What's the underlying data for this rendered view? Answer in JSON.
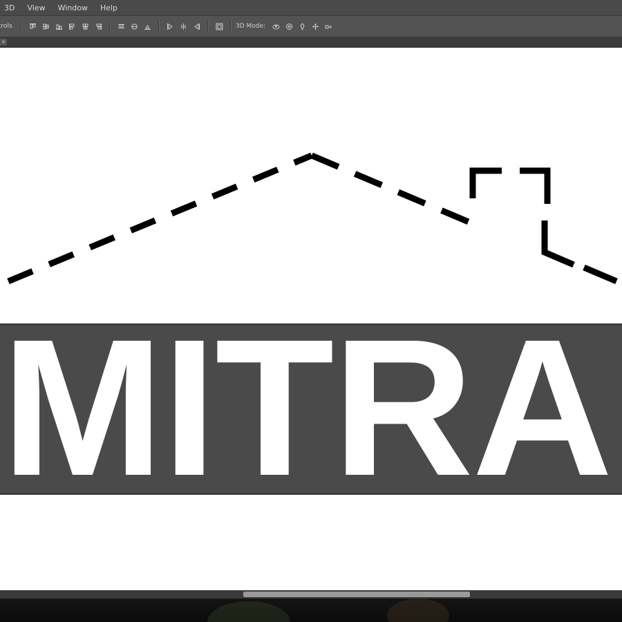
{
  "menubar": {
    "items": [
      "3D",
      "View",
      "Window",
      "Help"
    ]
  },
  "optionsbar": {
    "first_label": "trols",
    "mode_label": "3D Mode:"
  },
  "tab": {
    "close_glyph": "×"
  },
  "canvas": {
    "logo_text": "MITRA",
    "banner_color": "#4a4a4a",
    "background": "#ffffff",
    "roof_color": "#000000"
  },
  "icons": {
    "align": [
      "align-top-edges-icon",
      "align-vertical-centers-icon",
      "align-bottom-edges-icon",
      "align-left-edges-icon",
      "align-horizontal-centers-icon",
      "align-right-edges-icon"
    ],
    "distribute": [
      "distribute-top-icon",
      "distribute-vcenter-icon",
      "distribute-bottom-icon",
      "distribute-left-icon",
      "distribute-hcenter-icon",
      "distribute-right-icon"
    ],
    "auto_align": "auto-align-layers-icon",
    "mode3d": [
      "orbit-3d-icon",
      "roll-3d-icon",
      "pan-3d-icon",
      "slide-3d-icon",
      "scale-3d-icon"
    ]
  }
}
